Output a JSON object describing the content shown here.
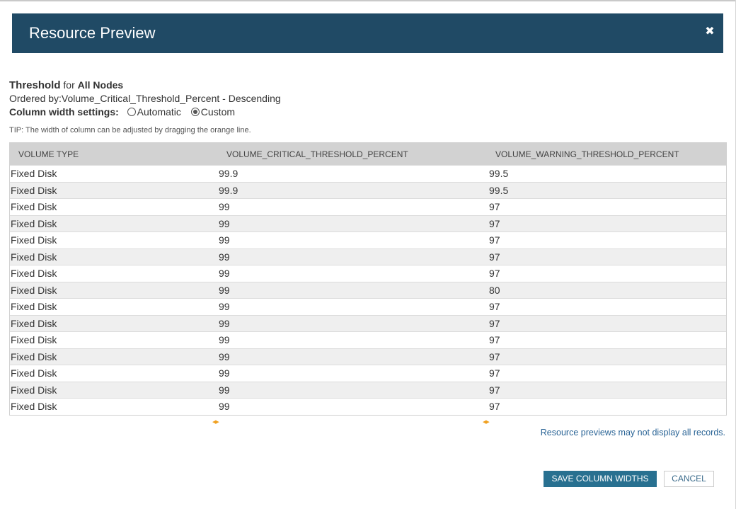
{
  "dialog": {
    "title": "Resource Preview",
    "close_icon": "close-icon"
  },
  "info": {
    "threshold_label": "Threshold",
    "for_text": "for",
    "scope": "All Nodes",
    "ordered_by": "Ordered by:Volume_Critical_Threshold_Percent - Descending",
    "column_width_label": "Column width settings:",
    "option_automatic": "Automatic",
    "option_custom": "Custom",
    "selected_option": "Custom",
    "tip": "TIP: The width of column can be adjusted by dragging the orange line."
  },
  "table": {
    "headers": [
      "VOLUME TYPE",
      "VOLUME_CRITICAL_THRESHOLD_PERCENT",
      "VOLUME_WARNING_THRESHOLD_PERCENT"
    ],
    "rows": [
      [
        "Fixed Disk",
        "99.9",
        "99.5"
      ],
      [
        "Fixed Disk",
        "99.9",
        "99.5"
      ],
      [
        "Fixed Disk",
        "99",
        "97"
      ],
      [
        "Fixed Disk",
        "99",
        "97"
      ],
      [
        "Fixed Disk",
        "99",
        "97"
      ],
      [
        "Fixed Disk",
        "99",
        "97"
      ],
      [
        "Fixed Disk",
        "99",
        "97"
      ],
      [
        "Fixed Disk",
        "99",
        "80"
      ],
      [
        "Fixed Disk",
        "99",
        "97"
      ],
      [
        "Fixed Disk",
        "99",
        "97"
      ],
      [
        "Fixed Disk",
        "99",
        "97"
      ],
      [
        "Fixed Disk",
        "99",
        "97"
      ],
      [
        "Fixed Disk",
        "99",
        "97"
      ],
      [
        "Fixed Disk",
        "99",
        "97"
      ],
      [
        "Fixed Disk",
        "99",
        "97"
      ]
    ]
  },
  "footer": {
    "note": "Resource previews may not display all records.",
    "save_label": "SAVE COLUMN WIDTHS",
    "cancel_label": "CANCEL"
  },
  "colors": {
    "header_bg": "#204a65",
    "primary_button": "#287090",
    "resize_handle": "#f0a020"
  }
}
